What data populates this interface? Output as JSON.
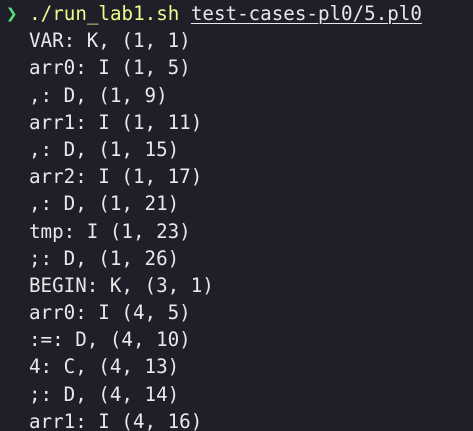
{
  "prompt": {
    "symbol": "❯",
    "command": "./run_lab1.sh",
    "argument": "test-cases-pl0/5.pl0"
  },
  "output_lines": [
    "VAR: K, (1, 1)",
    "arr0: I (1, 5)",
    ",: D, (1, 9)",
    "arr1: I (1, 11)",
    ",: D, (1, 15)",
    "arr2: I (1, 17)",
    ",: D, (1, 21)",
    "tmp: I (1, 23)",
    ";: D, (1, 26)",
    "BEGIN: K, (3, 1)",
    "arr0: I (4, 5)",
    ":=: D, (4, 10)",
    "4: C, (4, 13)",
    ";: D, (4, 14)",
    "arr1: I (4, 16)"
  ],
  "colors": {
    "background": "#1e1f29",
    "prompt_symbol": "#4ee07a",
    "command": "#f1fa8c",
    "text": "#e8e8e8"
  }
}
